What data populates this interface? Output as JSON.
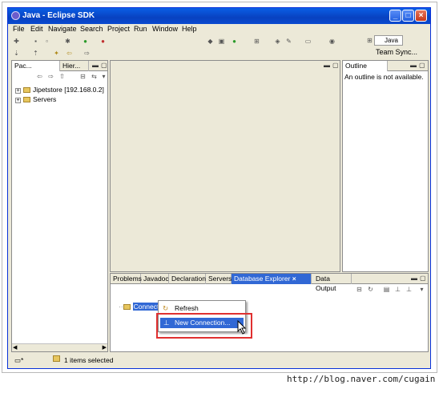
{
  "window": {
    "title": "Java - Eclipse SDK",
    "minimize_glyph": "_",
    "maximize_glyph": "□",
    "close_glyph": "×"
  },
  "menu": [
    "File",
    "Edit",
    "Navigate",
    "Search",
    "Project",
    "Run",
    "Window",
    "Help"
  ],
  "perspective": {
    "java_label": "Java",
    "team_sync_label": "Team Sync..."
  },
  "package_explorer": {
    "tabs": [
      "Pac...",
      "Hier..."
    ],
    "items": [
      {
        "label": "Jipetstore  [192.168.0.2]"
      },
      {
        "label": "Servers"
      }
    ]
  },
  "outline": {
    "tab_label": "Outline",
    "message": "An outline is not available."
  },
  "bottom_panel": {
    "tabs": [
      "Problems",
      "Javadoc",
      "Declaration",
      "Servers",
      "Database Explorer",
      "Data Output"
    ],
    "active_tab_index": 4,
    "tree_root": "Connections"
  },
  "context_menu": {
    "items": [
      {
        "label": "Refresh",
        "highlighted": false
      },
      {
        "label": "New Connection...",
        "highlighted": true
      }
    ]
  },
  "status": {
    "selection_text": "1 items selected"
  },
  "footer": {
    "url": "http://blog.naver.com/cugain"
  },
  "colors": {
    "accent": "#3168d5",
    "highlight_box": "#e03030",
    "title_blue": "#0841c0"
  }
}
